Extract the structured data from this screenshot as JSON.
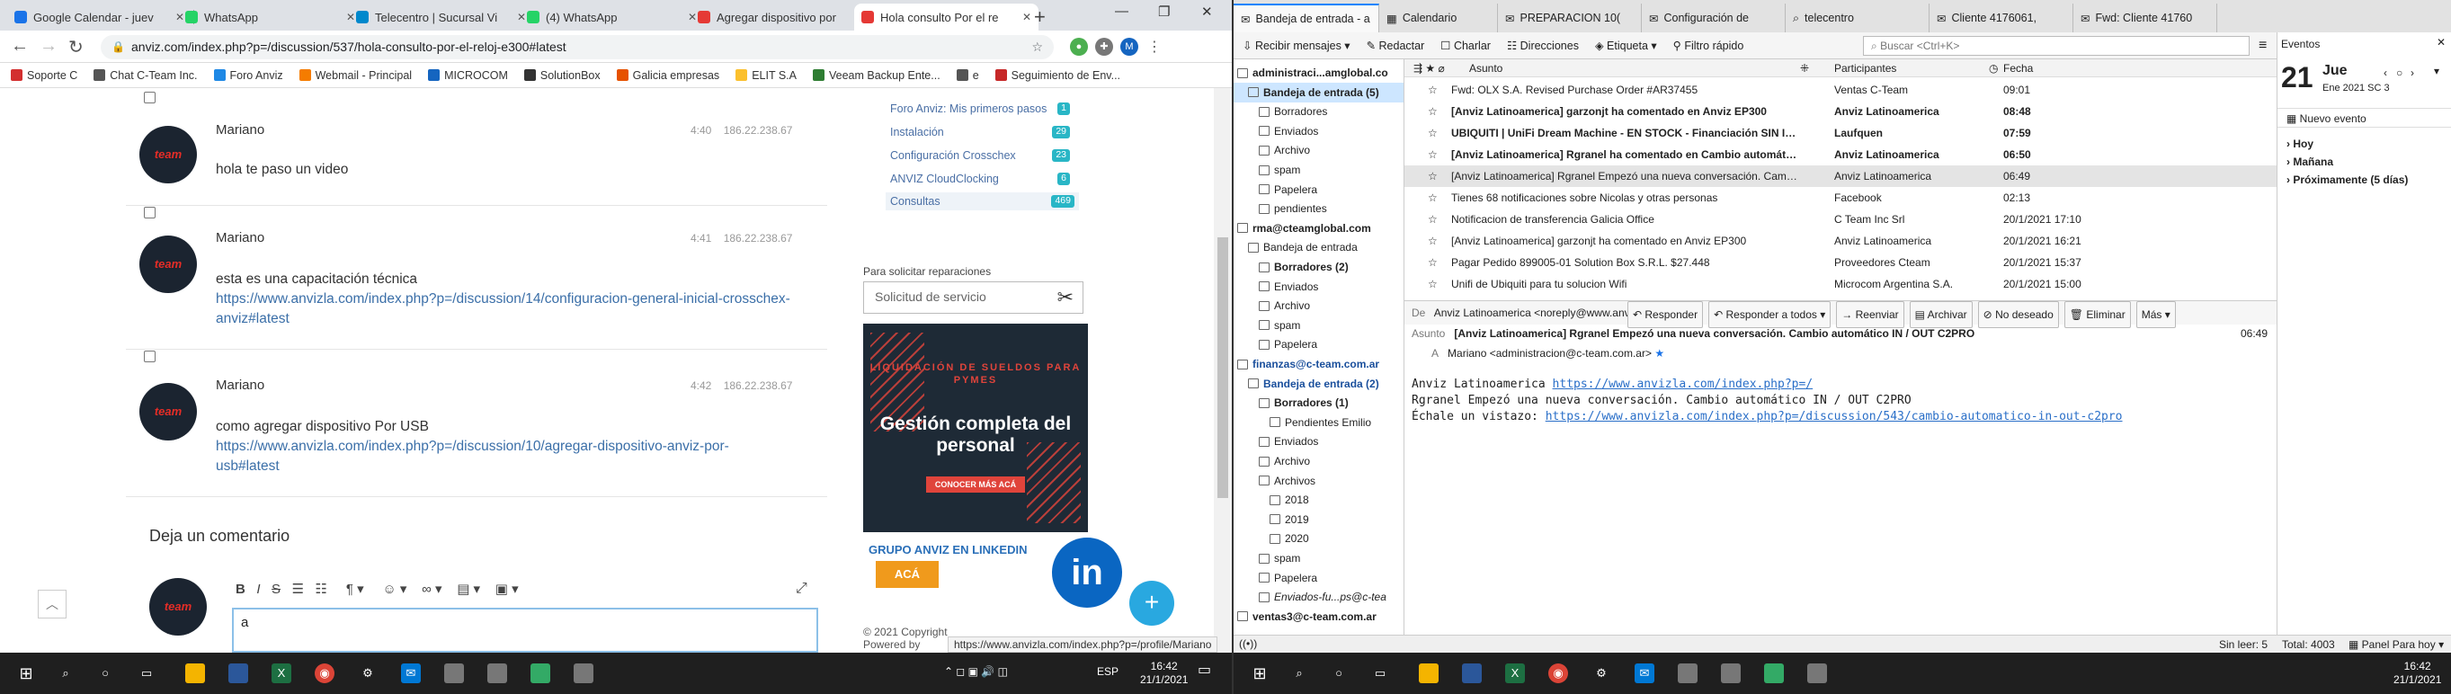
{
  "left": {
    "tabs": [
      {
        "title": "Google Calendar - juev",
        "fav": "#1a73e8"
      },
      {
        "title": "WhatsApp",
        "fav": "#25d366"
      },
      {
        "title": "Telecentro | Sucursal Vi",
        "fav": "#0088cc"
      },
      {
        "title": "(4) WhatsApp",
        "fav": "#25d366"
      },
      {
        "title": "Agregar dispositivo por",
        "fav": "#e53935"
      },
      {
        "title": "Hola consulto Por el re",
        "fav": "#e53935",
        "active": true
      }
    ],
    "new_tab": "+",
    "window_controls": {
      "min": "—",
      "max": "❐",
      "close": "✕"
    },
    "url": "anviz.com/index.php?p=/discussion/537/hola-consulto-por-el-reloj-e300#latest",
    "bookmarks": [
      {
        "label": "Soporte C",
        "fav": "#d32f2f"
      },
      {
        "label": "Chat C-Team Inc.",
        "fav": "#555"
      },
      {
        "label": "Foro Anviz",
        "fav": "#1e88e5"
      },
      {
        "label": "Webmail - Principal",
        "fav": "#f57c00"
      },
      {
        "label": "MICROCOM",
        "fav": "#1565c0"
      },
      {
        "label": "SolutionBox",
        "fav": "#333"
      },
      {
        "label": "Galicia empresas",
        "fav": "#e65100"
      },
      {
        "label": "ELIT S.A",
        "fav": "#fbc02d"
      },
      {
        "label": "Veeam Backup Ente...",
        "fav": "#2e7d32"
      },
      {
        "label": "e",
        "fav": "#555"
      },
      {
        "label": "Seguimiento de Env...",
        "fav": "#c62828"
      }
    ],
    "comments": [
      {
        "author": "Mariano",
        "time": "4:40",
        "ip": "186.22.238.67",
        "text": "hola te paso un video",
        "link": ""
      },
      {
        "author": "Mariano",
        "time": "4:41",
        "ip": "186.22.238.67",
        "text": "esta es una capacitación técnica",
        "link": "https://www.anvizla.com/index.php?p=/discussion/14/configuracion-general-inicial-crosschex-anviz#latest"
      },
      {
        "author": "Mariano",
        "time": "4:42",
        "ip": "186.22.238.67",
        "text": "como agregar dispositivo Por USB",
        "link": "https://www.anvizla.com/index.php?p=/discussion/10/agregar-dispositivo-anviz-por-usb#latest"
      }
    ],
    "avatar_text": "team",
    "leave_comment": "Deja un comentario",
    "editor_text": "a",
    "sidebar": {
      "items": [
        {
          "label": "Foro Anviz: Mis primeros pasos",
          "count": "1"
        },
        {
          "label": "Instalación",
          "count": "29"
        },
        {
          "label": "Configuración Crosschex",
          "count": "23"
        },
        {
          "label": "ANVIZ CloudClocking",
          "count": "6"
        },
        {
          "label": "Consultas",
          "count": "469"
        }
      ],
      "repair_title": "Para solicitar reparaciones",
      "repair_button": "Solicitud de servicio",
      "banner_line1": "LIQUIDACIÓN DE SUELDOS PARA PYMES",
      "banner_line2": "Gestión completa del personal",
      "banner_cta": "CONOCER MÁS ACÁ",
      "linkedin_title": "GRUPO ANVIZ EN LINKEDIN",
      "linkedin_btn": "ACÁ",
      "copyright": "© 2021 Copyright",
      "powered": "Powered by"
    },
    "status_url": "https://www.anvizla.com/index.php?p=/profile/Mariano",
    "taskbar": {
      "lang": "ESP",
      "time": "16:42",
      "date": "21/1/2021"
    }
  },
  "right": {
    "tabs": [
      {
        "title": "Bandeja de entrada - a",
        "active": true
      },
      {
        "title": "Calendario"
      },
      {
        "title": "PREPARACION 10("
      },
      {
        "title": "Configuración de"
      },
      {
        "title": "telecentro"
      },
      {
        "title": "Cliente 4176061,"
      },
      {
        "title": "Fwd: Cliente 41760"
      }
    ],
    "toolbar": [
      "Recibir mensajes",
      "Redactar",
      "Charlar",
      "Direcciones",
      "Etiqueta",
      "Filtro rápido"
    ],
    "search_placeholder": "Buscar <Ctrl+K>",
    "folders": [
      {
        "label": "administraci...amglobal.co",
        "level": 0,
        "bold": true
      },
      {
        "label": "Bandeja de entrada (5)",
        "level": 1,
        "bold": true,
        "sel": true
      },
      {
        "label": "Borradores",
        "level": 2
      },
      {
        "label": "Enviados",
        "level": 2
      },
      {
        "label": "Archivo",
        "level": 2
      },
      {
        "label": "spam",
        "level": 2
      },
      {
        "label": "Papelera",
        "level": 2
      },
      {
        "label": "pendientes",
        "level": 2
      },
      {
        "label": "rma@cteamglobal.com",
        "level": 0,
        "bold": true
      },
      {
        "label": "Bandeja de entrada",
        "level": 1
      },
      {
        "label": "Borradores (2)",
        "level": 2,
        "bold": true
      },
      {
        "label": "Enviados",
        "level": 2
      },
      {
        "label": "Archivo",
        "level": 2
      },
      {
        "label": "spam",
        "level": 2
      },
      {
        "label": "Papelera",
        "level": 2
      },
      {
        "label": "finanzas@c-team.com.ar",
        "level": 0,
        "bold": true,
        "blue": true
      },
      {
        "label": "Bandeja de entrada (2)",
        "level": 1,
        "bold": true,
        "blue": true
      },
      {
        "label": "Borradores (1)",
        "level": 2,
        "bold": true
      },
      {
        "label": "Pendientes Emilio",
        "level": 3
      },
      {
        "label": "Enviados",
        "level": 2
      },
      {
        "label": "Archivo",
        "level": 2
      },
      {
        "label": "Archivos",
        "level": 2
      },
      {
        "label": "2018",
        "level": 3
      },
      {
        "label": "2019",
        "level": 3
      },
      {
        "label": "2020",
        "level": 3
      },
      {
        "label": "spam",
        "level": 2
      },
      {
        "label": "Papelera",
        "level": 2
      },
      {
        "label": "Enviados-fu...ps@c-tea",
        "level": 2,
        "italic": true
      },
      {
        "label": "ventas3@c-team.com.ar",
        "level": 0,
        "bold": true
      }
    ],
    "columns": {
      "subject": "Asunto",
      "from": "Participantes",
      "date": "Fecha"
    },
    "messages": [
      {
        "subject": "Fwd: OLX S.A. Revised Purchase Order #AR37455",
        "from": "Ventas C-Team",
        "date": "09:01"
      },
      {
        "subject": "[Anviz Latinoamerica] garzonjt ha comentado en Anviz EP300",
        "from": "Anviz Latinoamerica",
        "date": "08:48",
        "bold": true
      },
      {
        "subject": "UBIQUITI | UniFi Dream Machine - EN STOCK - Financiación SIN INT...",
        "from": "Laufquen",
        "date": "07:59",
        "bold": true
      },
      {
        "subject": "[Anviz Latinoamerica] Rgranel ha comentado en Cambio automático ...",
        "from": "Anviz Latinoamerica",
        "date": "06:50",
        "bold": true
      },
      {
        "subject": "[Anviz Latinoamerica] Rgranel Empezó una nueva conversación. Cambi...",
        "from": "Anviz Latinoamerica",
        "date": "06:49",
        "sel": true
      },
      {
        "subject": "Tienes 68 notificaciones sobre Nicolas y otras personas",
        "from": "Facebook",
        "date": "02:13"
      },
      {
        "subject": "Notificacion de transferencia Galicia Office",
        "from": "C Team Inc Srl",
        "date": "20/1/2021 17:10"
      },
      {
        "subject": "[Anviz Latinoamerica] garzonjt ha comentado en Anviz EP300",
        "from": "Anviz Latinoamerica",
        "date": "20/1/2021 16:21"
      },
      {
        "subject": "Pagar Pedido 899005-01 Solution Box S.R.L. $27.448",
        "from": "Proveedores Cteam",
        "date": "20/1/2021 15:37"
      },
      {
        "subject": "Unifi de Ubiquiti para tu solucion Wifi",
        "from": "Microcom Argentina S.A.",
        "date": "20/1/2021 15:00"
      }
    ],
    "preview": {
      "from_label": "De",
      "from": "Anviz Latinoamerica <noreply@www.anvizla.com>",
      "buttons": [
        "Responder",
        "Responder a todos",
        "Reenviar",
        "Archivar",
        "No deseado",
        "Eliminar",
        "Más"
      ],
      "subject_label": "Asunto",
      "subject": "[Anviz Latinoamerica] Rgranel Empezó una nueva conversación. Cambio automático IN / OUT C2PRO",
      "time": "06:49",
      "to_label": "A",
      "to": "Mariano <administracion@c-team.com.ar>",
      "body_line1": "Anviz Latinoamerica ",
      "body_link1": "https://www.anvizla.com/index.php?p=/",
      "body_line2": "Rgranel Empezó una nueva conversación. Cambio automático IN / OUT C2PRO",
      "body_line3": "Échale un vistazo: ",
      "body_link3": "https://www.anvizla.com/index.php?p=/discussion/543/cambio-automatico-in-out-c2pro"
    },
    "events": {
      "title": "Eventos",
      "day": "21",
      "month": "Jue",
      "sub": "Ene 2021  SC 3",
      "new_event": "Nuevo evento",
      "groups": [
        "Hoy",
        "Mañana",
        "Próximamente (5 días)"
      ]
    },
    "status": {
      "unread": "Sin leer: 5",
      "total": "Total: 4003",
      "panel": "Panel Para hoy"
    },
    "taskbar": {
      "time": "16:42",
      "date": "21/1/2021"
    }
  }
}
